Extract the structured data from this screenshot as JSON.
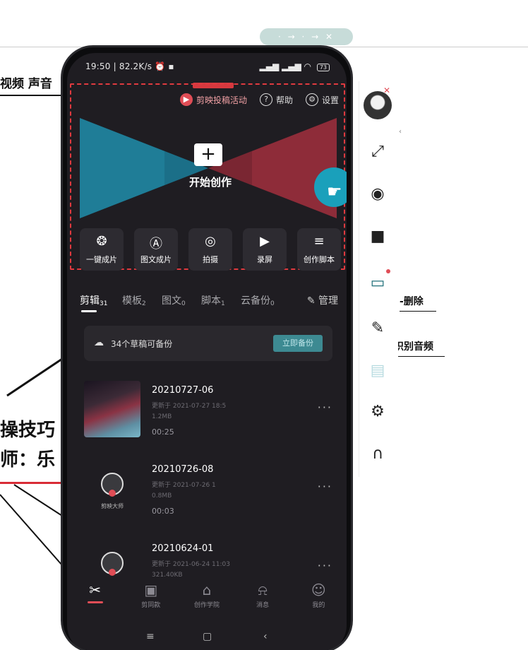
{
  "background": {
    "caption_pill": "· → · → ✕",
    "top_left_label": "视频 声音",
    "right_label_1": "-删除",
    "right_label_2": "识别音频",
    "left_big_1": "操技巧",
    "left_big_2": "师：乐"
  },
  "status_bar": {
    "time": "19:50",
    "speed": "82.2K/s",
    "signal": "▂▄▆ ▂▄▆ ◠",
    "battery": "73"
  },
  "top_links": [
    {
      "icon": "promo-icon",
      "label": "剪映投稿活动"
    },
    {
      "icon": "help-icon",
      "label": "帮助"
    },
    {
      "icon": "settings-icon",
      "label": "设置"
    }
  ],
  "hero": {
    "plus": "+",
    "label": "开始创作"
  },
  "tools": [
    {
      "name": "one-click",
      "glyph": "❂",
      "label": "一键成片"
    },
    {
      "name": "image-text",
      "glyph": "Ⓐ",
      "label": "图文成片"
    },
    {
      "name": "shoot",
      "glyph": "◎",
      "label": "拍摄"
    },
    {
      "name": "record-screen",
      "glyph": "▶",
      "label": "录屏"
    },
    {
      "name": "script",
      "glyph": "≡",
      "label": "创作脚本"
    }
  ],
  "tabs": [
    {
      "label": "剪辑",
      "count": "31"
    },
    {
      "label": "模板",
      "count": "2"
    },
    {
      "label": "图文",
      "count": "0"
    },
    {
      "label": "脚本",
      "count": "1"
    },
    {
      "label": "云备份",
      "count": "0"
    }
  ],
  "manage_label": "管理",
  "backup": {
    "text": "34个草稿可备份",
    "button": "立即备份"
  },
  "drafts": [
    {
      "name": "20210727-06",
      "line1": "更新于 2021-07-27 18:5",
      "line2": "1.2MB",
      "duration": "00:25"
    },
    {
      "name": "20210726-08",
      "line1": "更新于 2021-07-26 1",
      "line2": "0.8MB",
      "duration": "00:03"
    },
    {
      "name": "20210624-01",
      "line1": "更新于 2021-06-24 11:03",
      "line2": "321.40KB",
      "duration": ""
    }
  ],
  "logo_caption": "剪映大师",
  "more": "···",
  "bottom_nav": [
    {
      "icon": "scissors-icon",
      "glyph": "✂",
      "label": ""
    },
    {
      "icon": "cut-same-icon",
      "glyph": "▣",
      "label": "剪同款"
    },
    {
      "icon": "school-icon",
      "glyph": "⌂",
      "label": "创作学院"
    },
    {
      "icon": "bell-icon",
      "glyph": "⍾",
      "label": "消息"
    },
    {
      "icon": "user-icon",
      "glyph": "☺",
      "label": "我的"
    }
  ],
  "system_nav": {
    "menu": "≡",
    "home": "▢",
    "back": "‹"
  },
  "sidebar_icons": [
    {
      "name": "fullscreen-icon",
      "glyph": "⤢"
    },
    {
      "name": "camera-icon",
      "glyph": "◉"
    },
    {
      "name": "video-camera-icon",
      "glyph": "■"
    },
    {
      "name": "screen-pointer-icon",
      "glyph": "▭"
    },
    {
      "name": "brush-icon",
      "glyph": "✎"
    },
    {
      "name": "tv-icon",
      "glyph": "▤"
    },
    {
      "name": "settings-gear-icon",
      "glyph": "⚙"
    },
    {
      "name": "headset-icon",
      "glyph": "∩"
    }
  ],
  "colors": {
    "accent_red": "#e04d56",
    "teal": "#1aa0bb",
    "screen_bg": "#1f1d22"
  }
}
